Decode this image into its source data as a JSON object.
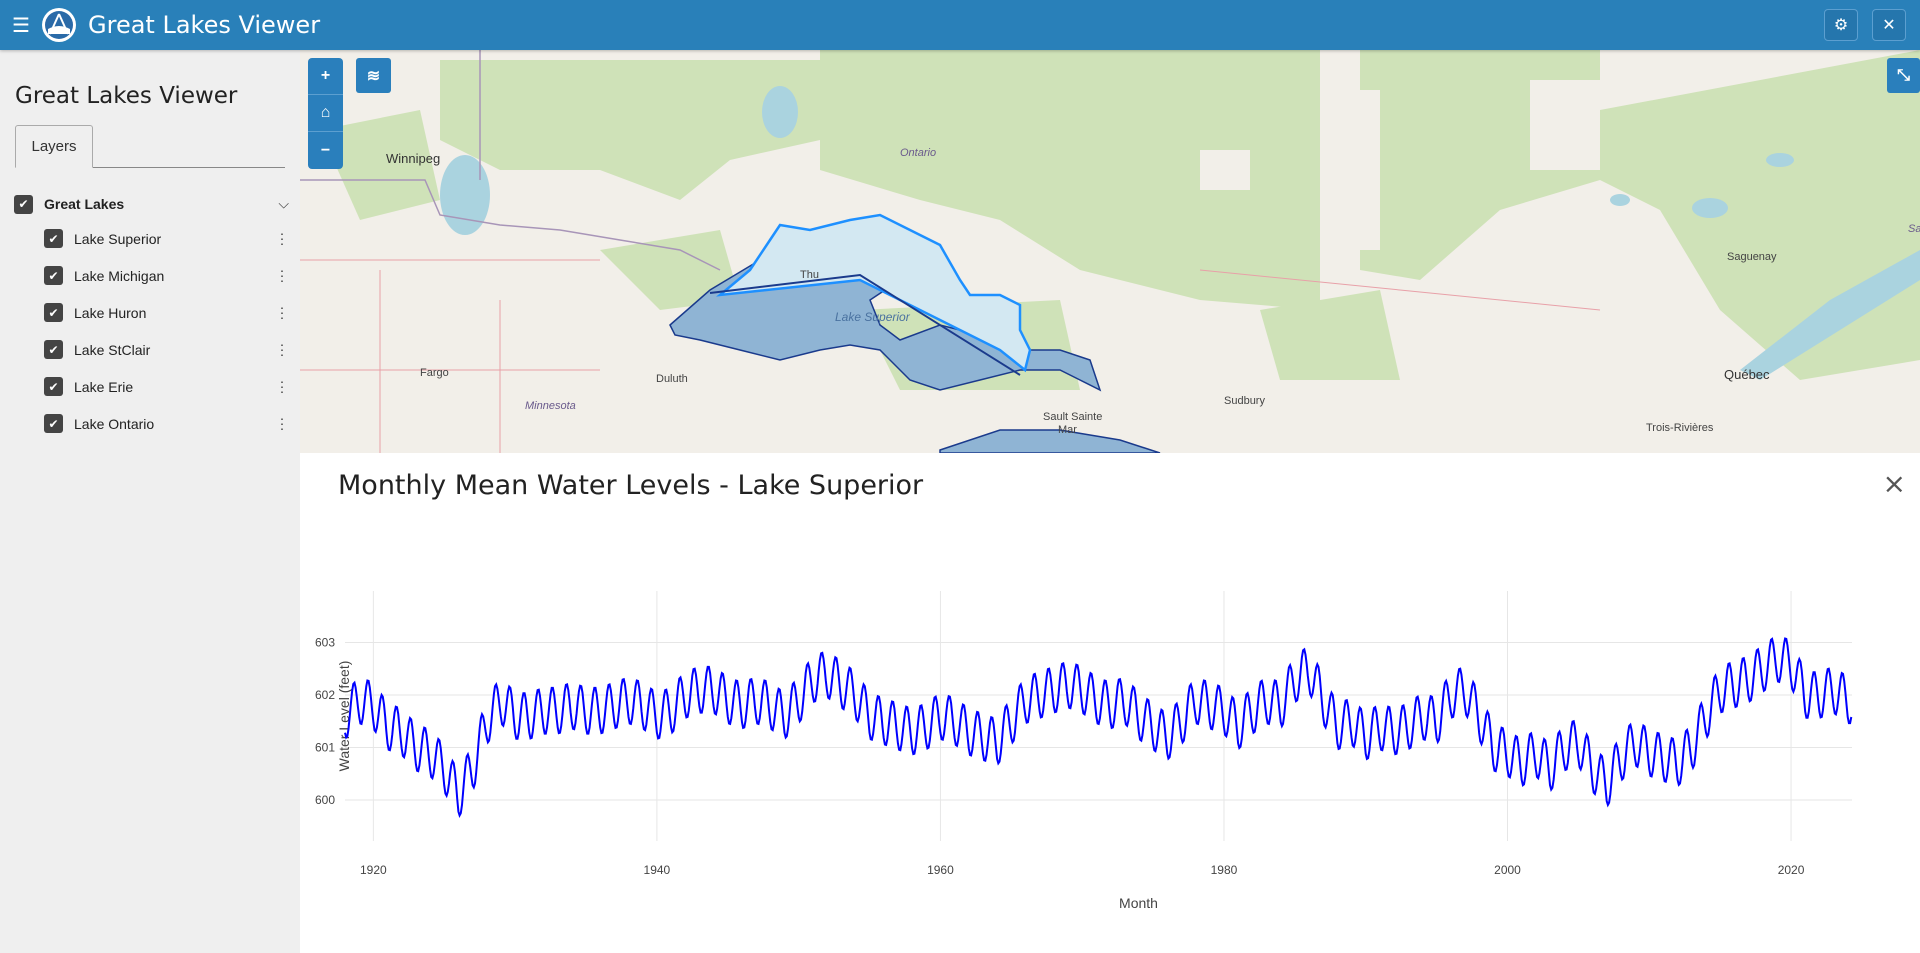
{
  "app": {
    "title": "Great Lakes Viewer",
    "menu_icon": "hamburger-icon",
    "settings_icon": "gear-icon",
    "close_icon": "close-icon"
  },
  "sidebar": {
    "title": "Great Lakes Viewer",
    "tab": "Layers",
    "group": {
      "label": "Great Lakes",
      "checked": true
    },
    "layers": [
      {
        "label": "Lake Superior",
        "checked": true
      },
      {
        "label": "Lake Michigan",
        "checked": true
      },
      {
        "label": "Lake Huron",
        "checked": true
      },
      {
        "label": "Lake StClair",
        "checked": true
      },
      {
        "label": "Lake Erie",
        "checked": true
      },
      {
        "label": "Lake Ontario",
        "checked": true
      }
    ]
  },
  "map": {
    "zoom_in": "+",
    "zoom_out": "−",
    "places": [
      "Winnipeg",
      "Ontario",
      "Thu",
      "Lake Superior",
      "Fargo",
      "Duluth",
      "Minnesota",
      "Sault Sainte",
      "Mar",
      "Sudbury",
      "Saguenay",
      "Québec",
      "Trois-Rivières",
      "Sa"
    ],
    "colors": {
      "lake_fill": "#8fb4d4",
      "lake_stroke": "#1a3a8c",
      "selected_fill": "#d3e8f2",
      "selected_stroke": "#1e90ff"
    }
  },
  "panel": {
    "title": "Monthly Mean Water Levels - Lake Superior",
    "close": "×"
  },
  "chart_data": {
    "type": "line",
    "title": "Monthly Mean Water Levels - Lake Superior",
    "xlabel": "Month",
    "ylabel": "Water Level (feet)",
    "x_ticks": [
      "1920",
      "1940",
      "1960",
      "1980",
      "2000",
      "2020"
    ],
    "y_ticks": [
      "600",
      "601",
      "602",
      "603"
    ],
    "xlim": [
      1918,
      2024.3
    ],
    "ylim": [
      599.6,
      603.6
    ],
    "grid": true,
    "series": [
      {
        "color": "#0000ff",
        "annual": [
          [
            1918,
            601.6
          ],
          [
            1919,
            601.9
          ],
          [
            1920,
            601.8
          ],
          [
            1921,
            601.4
          ],
          [
            1922,
            601.3
          ],
          [
            1923,
            601.0
          ],
          [
            1924,
            600.9
          ],
          [
            1925,
            600.6
          ],
          [
            1926,
            600.1
          ],
          [
            1927,
            600.6
          ],
          [
            1928,
            601.5
          ],
          [
            1929,
            601.9
          ],
          [
            1930,
            601.6
          ],
          [
            1931,
            601.6
          ],
          [
            1932,
            601.7
          ],
          [
            1933,
            601.7
          ],
          [
            1934,
            601.8
          ],
          [
            1935,
            601.7
          ],
          [
            1936,
            601.7
          ],
          [
            1937,
            601.8
          ],
          [
            1938,
            601.9
          ],
          [
            1939,
            601.8
          ],
          [
            1940,
            601.6
          ],
          [
            1941,
            601.7
          ],
          [
            1942,
            602.0
          ],
          [
            1943,
            602.1
          ],
          [
            1944,
            602.1
          ],
          [
            1945,
            601.9
          ],
          [
            1946,
            601.8
          ],
          [
            1947,
            601.9
          ],
          [
            1948,
            601.8
          ],
          [
            1949,
            601.6
          ],
          [
            1950,
            601.9
          ],
          [
            1951,
            602.3
          ],
          [
            1952,
            602.4
          ],
          [
            1953,
            602.2
          ],
          [
            1954,
            602.0
          ],
          [
            1955,
            601.6
          ],
          [
            1956,
            601.5
          ],
          [
            1957,
            601.4
          ],
          [
            1958,
            601.3
          ],
          [
            1959,
            601.4
          ],
          [
            1960,
            601.6
          ],
          [
            1961,
            601.5
          ],
          [
            1962,
            601.3
          ],
          [
            1963,
            601.2
          ],
          [
            1964,
            601.1
          ],
          [
            1965,
            601.5
          ],
          [
            1966,
            601.9
          ],
          [
            1967,
            602.0
          ],
          [
            1968,
            602.1
          ],
          [
            1969,
            602.2
          ],
          [
            1970,
            602.1
          ],
          [
            1971,
            601.9
          ],
          [
            1972,
            601.8
          ],
          [
            1973,
            601.9
          ],
          [
            1974,
            601.6
          ],
          [
            1975,
            601.4
          ],
          [
            1976,
            601.2
          ],
          [
            1977,
            601.5
          ],
          [
            1978,
            601.9
          ],
          [
            1979,
            601.8
          ],
          [
            1980,
            601.7
          ],
          [
            1981,
            601.4
          ],
          [
            1982,
            601.7
          ],
          [
            1983,
            601.9
          ],
          [
            1984,
            601.8
          ],
          [
            1985,
            602.3
          ],
          [
            1986,
            602.5
          ],
          [
            1987,
            601.9
          ],
          [
            1988,
            601.4
          ],
          [
            1989,
            601.5
          ],
          [
            1990,
            601.2
          ],
          [
            1991,
            601.4
          ],
          [
            1992,
            601.3
          ],
          [
            1993,
            601.4
          ],
          [
            1994,
            601.6
          ],
          [
            1995,
            601.5
          ],
          [
            1996,
            602.0
          ],
          [
            1997,
            602.1
          ],
          [
            1998,
            601.6
          ],
          [
            1999,
            601.0
          ],
          [
            2000,
            600.9
          ],
          [
            2001,
            600.7
          ],
          [
            2002,
            600.9
          ],
          [
            2003,
            600.6
          ],
          [
            2004,
            601.0
          ],
          [
            2005,
            601.1
          ],
          [
            2006,
            600.6
          ],
          [
            2007,
            600.3
          ],
          [
            2008,
            600.8
          ],
          [
            2009,
            601.1
          ],
          [
            2010,
            600.9
          ],
          [
            2011,
            600.8
          ],
          [
            2012,
            600.7
          ],
          [
            2013,
            601.0
          ],
          [
            2014,
            601.6
          ],
          [
            2015,
            602.1
          ],
          [
            2016,
            602.2
          ],
          [
            2017,
            602.3
          ],
          [
            2018,
            602.5
          ],
          [
            2019,
            602.7
          ],
          [
            2020,
            602.6
          ],
          [
            2021,
            602.0
          ],
          [
            2022,
            602.0
          ],
          [
            2023,
            602.1
          ],
          [
            2024,
            601.9
          ]
        ],
        "seasonal_amplitude": 0.45
      }
    ]
  }
}
